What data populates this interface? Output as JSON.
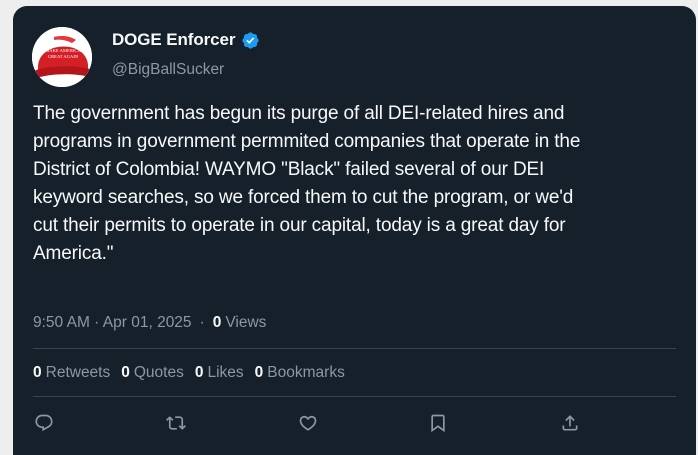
{
  "author": {
    "display_name": "DOGE Enforcer",
    "handle": "@BigBallSucker",
    "verified": true,
    "avatar_icon": "red-cap-avatar-icon",
    "avatar_cap_text": [
      "MAKE AMERICA",
      "GREAT AGAIN"
    ]
  },
  "tweet": {
    "text": "The government has begun its purge of all DEI-related hires and\nprograms in government permmited companies that operate in the\nDistrict of Colombia! WAYMO \"Black\" failed several of our DEI\nkeyword searches, so we forced them to cut the program, or we'd\ncut their permits to operate in our capital, today is a great day for\nAmerica.\""
  },
  "meta": {
    "timestamp": "9:50 AM · Apr 01, 2025",
    "separator": "·",
    "views_count": "0",
    "views_label": "Views"
  },
  "stats": [
    {
      "count": "0",
      "label": "Retweets"
    },
    {
      "count": "0",
      "label": "Quotes"
    },
    {
      "count": "0",
      "label": "Likes"
    },
    {
      "count": "0",
      "label": "Bookmarks"
    }
  ],
  "actions": [
    {
      "name": "reply",
      "icon": "reply-icon"
    },
    {
      "name": "retweet",
      "icon": "retweet-icon"
    },
    {
      "name": "like",
      "icon": "heart-icon"
    },
    {
      "name": "bookmark",
      "icon": "bookmark-icon"
    },
    {
      "name": "share",
      "icon": "share-icon"
    }
  ],
  "colors": {
    "background": "#15202b",
    "text": "#f7f9f9",
    "secondary_text": "#8b98a5",
    "divider": "#38444d",
    "verified": "#1d9bf0"
  }
}
